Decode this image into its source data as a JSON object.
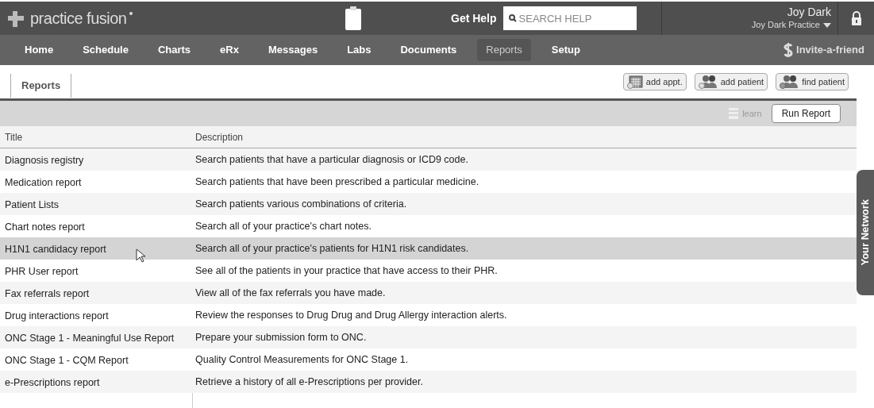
{
  "header": {
    "logo": "practice fusion",
    "get_help": "Get Help",
    "search": {
      "placeholder": "SEARCH HELP"
    },
    "user_name": "Joy Dark",
    "practice": "Joy Dark Practice"
  },
  "nav": [
    {
      "label": "Home",
      "selected": false
    },
    {
      "label": "Schedule",
      "selected": false
    },
    {
      "label": "Charts",
      "selected": false
    },
    {
      "label": "eRx",
      "selected": false
    },
    {
      "label": "Messages",
      "selected": false
    },
    {
      "label": "Labs",
      "selected": false
    },
    {
      "label": "Documents",
      "selected": false
    },
    {
      "label": "Reports",
      "selected": true
    },
    {
      "label": "Setup",
      "selected": false
    }
  ],
  "invite": "Invite-a-friend",
  "page_tab": "Reports",
  "quick_buttons": [
    {
      "kind": "appt",
      "label": "add appt."
    },
    {
      "kind": "add",
      "label": "add patient"
    },
    {
      "kind": "find",
      "label": "find patient"
    }
  ],
  "toolbar": {
    "learn": "learn",
    "run": "Run Report"
  },
  "table": {
    "columns": [
      "Title",
      "Description"
    ],
    "rows": [
      {
        "title": "Diagnosis registry",
        "description": "Search patients that have a particular diagnosis or ICD9 code.",
        "selected": false
      },
      {
        "title": "Medication report",
        "description": "Search patients that have been prescribed a particular medicine.",
        "selected": false
      },
      {
        "title": "Patient Lists",
        "description": "Search patients various combinations of criteria.",
        "selected": false
      },
      {
        "title": "Chart notes report",
        "description": "Search all of your practice's chart notes.",
        "selected": false
      },
      {
        "title": "H1N1 candidacy report",
        "description": "Search all of your practice's patients for H1N1 risk candidates.",
        "selected": true
      },
      {
        "title": "PHR User report",
        "description": "See all of the patients in your practice that have access to their PHR.",
        "selected": false
      },
      {
        "title": "Fax referrals report",
        "description": "View all of the fax referrals you have made.",
        "selected": false
      },
      {
        "title": "Drug interactions report",
        "description": "Review the responses to Drug Drug and Drug Allergy interaction alerts.",
        "selected": false
      },
      {
        "title": "ONC Stage 1 - Meaningful Use Report",
        "description": "Prepare your submission form to ONC.",
        "selected": false
      },
      {
        "title": "ONC Stage 1 - CQM Report",
        "description": "Quality Control Measurements for ONC Stage 1.",
        "selected": false
      },
      {
        "title": "e-Prescriptions report",
        "description": "Retrieve a history of all e-Prescriptions per provider.",
        "selected": false
      }
    ]
  },
  "side_tab": "Your Network"
}
